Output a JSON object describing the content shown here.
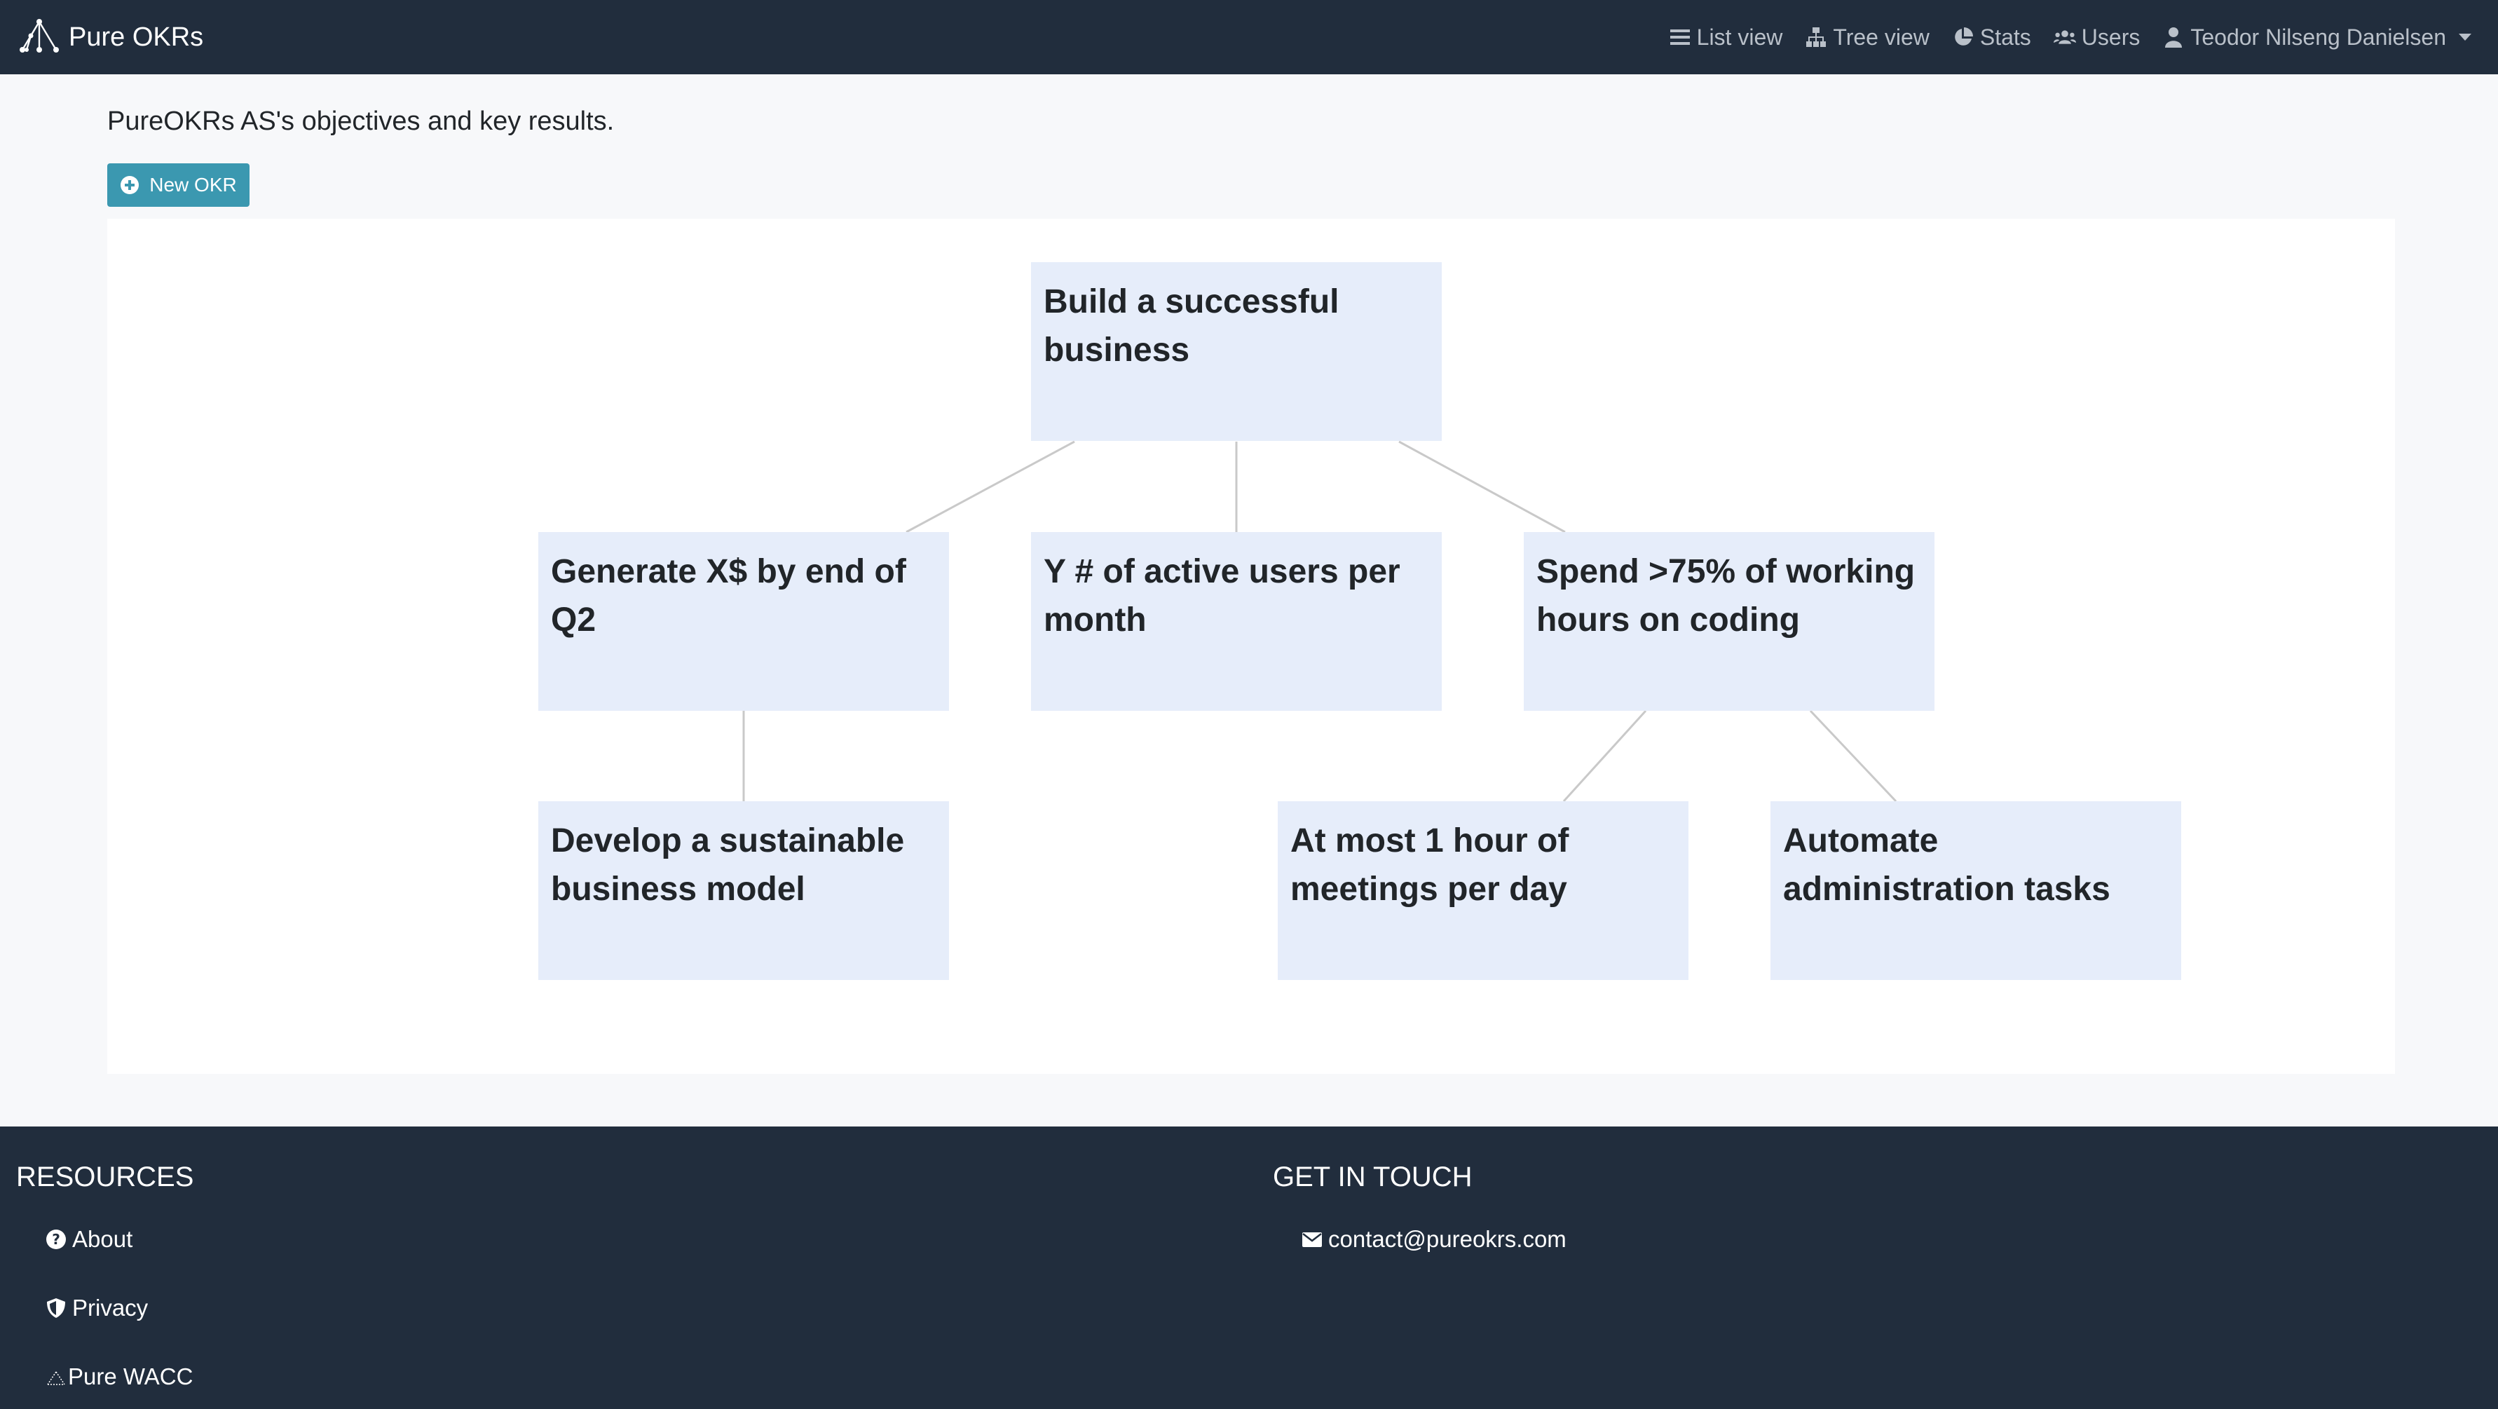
{
  "navbar": {
    "brand": "Pure OKRs",
    "items": [
      {
        "label": "List view",
        "icon": "list-icon"
      },
      {
        "label": "Tree view",
        "icon": "sitemap-icon"
      },
      {
        "label": "Stats",
        "icon": "pie-chart-icon"
      },
      {
        "label": "Users",
        "icon": "users-icon"
      },
      {
        "label": "Teodor Nilseng Danielsen",
        "icon": "user-icon"
      }
    ]
  },
  "main": {
    "subtitle": "PureOKRs AS's objectives and key results.",
    "new_okr_label": "New OKR",
    "tree": {
      "root": "Build a successful business",
      "level1": [
        "Generate X$ by end of Q2",
        "Y # of active users per month",
        "Spend >75% of working hours on coding"
      ],
      "level2": [
        "Develop a sustainable business model",
        "At most 1 hour of meetings per day",
        "Automate administration tasks"
      ]
    }
  },
  "footer": {
    "resources_heading": "RESOURCES",
    "resources": [
      {
        "label": "About",
        "icon": "question-circle-icon"
      },
      {
        "label": "Privacy",
        "icon": "shield-icon"
      },
      {
        "label": "Pure WACC",
        "icon": "pure-wacc-logo-icon"
      }
    ],
    "contact_heading": "GET IN TOUCH",
    "contact_email": "contact@pureokrs.com"
  },
  "colors": {
    "navbar_bg": "#212d3d",
    "node_bg": "#e6edfa",
    "button_bg": "#3b98b0",
    "page_bg": "#f7f8fa"
  }
}
